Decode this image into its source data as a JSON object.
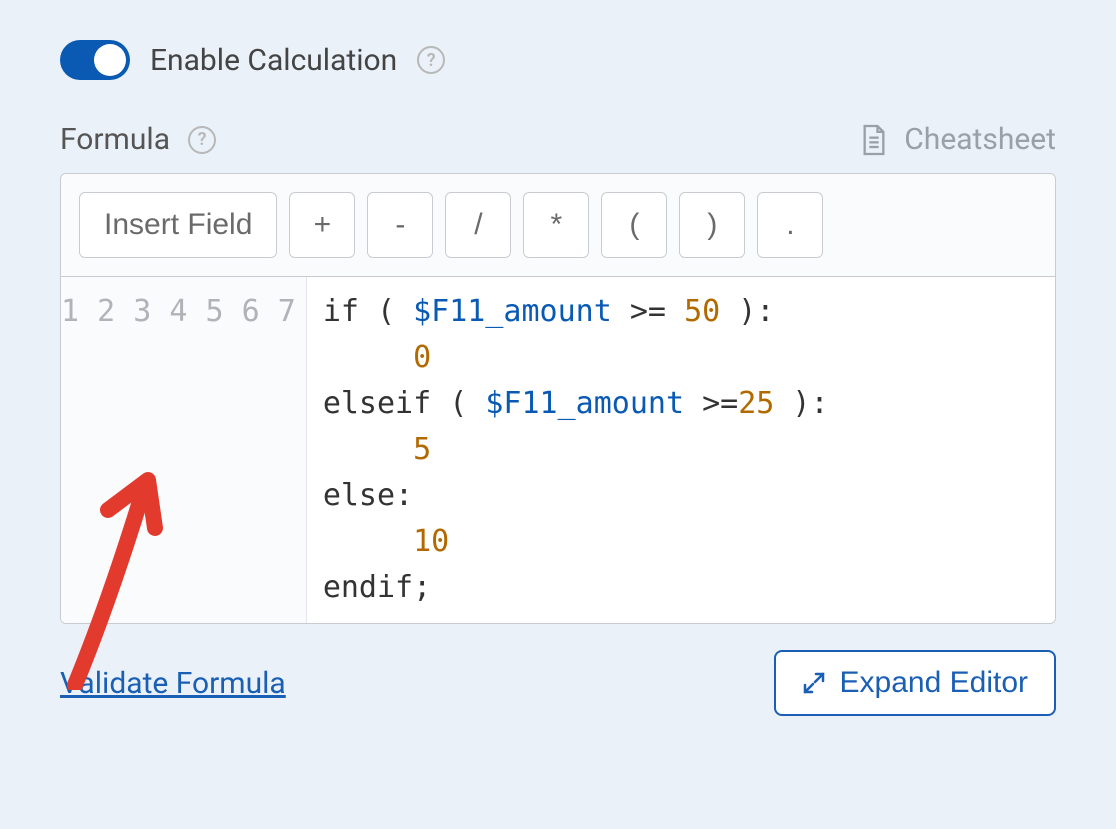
{
  "toggle": {
    "label": "Enable Calculation",
    "state": "on"
  },
  "formula_header": {
    "title": "Formula",
    "cheatsheet_label": "Cheatsheet"
  },
  "toolbar": {
    "insert_field": "Insert Field",
    "ops": {
      "plus": "+",
      "minus": "-",
      "slash": "/",
      "star": "*",
      "lparen": "(",
      "rparen": ")",
      "dot": "."
    }
  },
  "code": {
    "line_numbers": [
      "1",
      "2",
      "3",
      "4",
      "5",
      "6",
      "7"
    ],
    "lines": [
      {
        "segments": [
          {
            "cls": "tok-kw",
            "t": "if "
          },
          {
            "cls": "tok-par",
            "t": "( "
          },
          {
            "cls": "tok-var",
            "t": "$F11_amount"
          },
          {
            "cls": "tok-op",
            "t": " >= "
          },
          {
            "cls": "tok-num",
            "t": "50"
          },
          {
            "cls": "tok-par",
            "t": " )"
          },
          {
            "cls": "tok-kw",
            "t": ":"
          }
        ]
      },
      {
        "segments": [
          {
            "cls": "",
            "t": "     "
          },
          {
            "cls": "tok-num",
            "t": "0"
          }
        ]
      },
      {
        "segments": [
          {
            "cls": "tok-kw",
            "t": "elseif "
          },
          {
            "cls": "tok-par",
            "t": "( "
          },
          {
            "cls": "tok-var",
            "t": "$F11_amount"
          },
          {
            "cls": "tok-op",
            "t": " >="
          },
          {
            "cls": "tok-num",
            "t": "25"
          },
          {
            "cls": "tok-par",
            "t": " )"
          },
          {
            "cls": "tok-kw",
            "t": ":"
          }
        ]
      },
      {
        "segments": [
          {
            "cls": "",
            "t": "     "
          },
          {
            "cls": "tok-num",
            "t": "5"
          }
        ]
      },
      {
        "segments": [
          {
            "cls": "tok-kw",
            "t": "else:"
          }
        ]
      },
      {
        "segments": [
          {
            "cls": "",
            "t": "     "
          },
          {
            "cls": "tok-num",
            "t": "10"
          }
        ]
      },
      {
        "segments": [
          {
            "cls": "tok-kw",
            "t": "endif;"
          }
        ]
      }
    ]
  },
  "footer": {
    "validate": "Validate Formula",
    "expand": "Expand Editor"
  }
}
